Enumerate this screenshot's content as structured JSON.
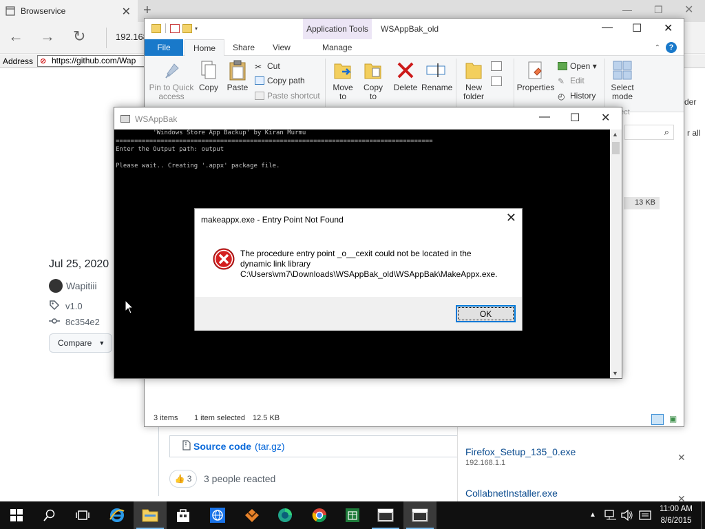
{
  "browser": {
    "tab_title": "Browservice",
    "url_partial": "192.168",
    "address_label": "Address",
    "address_value": "https://github.com/Wap",
    "release": {
      "date": "Jul 25, 2020",
      "user": "Wapitiii",
      "tag": "v1.0",
      "commit": "8c354e2",
      "compare_label": "Compare"
    },
    "asset": {
      "label": "Source code",
      "format": "(tar.gz)"
    },
    "reactions": {
      "count": "3",
      "text": "3 people reacted"
    },
    "downloads": [
      {
        "name": "Firefox_Setup_135_0.exe",
        "source": "192.168.1.1"
      },
      {
        "name": "CollabnetInstaller.exe",
        "source": ""
      }
    ],
    "right_strip": {
      "t1": "der",
      "t2": "r all"
    }
  },
  "explorer": {
    "app_tools_label": "Application Tools",
    "window_title": "WSAppBak_old",
    "tabs": {
      "file": "File",
      "home": "Home",
      "share": "Share",
      "view": "View",
      "manage": "Manage"
    },
    "ribbon": {
      "pin": "Pin to Quick access",
      "copy": "Copy",
      "paste": "Paste",
      "cut": "Cut",
      "copy_path": "Copy path",
      "paste_shortcut": "Paste shortcut",
      "move_to": "Move to",
      "copy_to": "Copy to",
      "delete": "Delete",
      "rename": "Rename",
      "new_folder": "New folder",
      "properties": "Properties",
      "open": "Open",
      "edit": "Edit",
      "history": "History",
      "select_mode": "Select mode",
      "select_partial": "ect"
    },
    "file_size": "13 KB",
    "status": {
      "items": "3 items",
      "selected": "1 item selected",
      "size": "12.5 KB"
    }
  },
  "console": {
    "title": "WSAppBak",
    "lines": [
      "          'Windows Store App Backup' by Kiran Murmu",
      "=====================================================================================",
      "Enter the Output path: output",
      "",
      "Please wait.. Creating '.appx' package file."
    ]
  },
  "dialog": {
    "title": "makeappx.exe - Entry Point Not Found",
    "message_line1": "The procedure entry point _o__cexit could not be located in the",
    "message_line2": "dynamic link library",
    "message_line3": "C:\\Users\\vm7\\Downloads\\WSAppBak_old\\WSAppBak\\MakeAppx.exe.",
    "ok_label": "OK"
  },
  "taskbar": {
    "time": "11:00 AM",
    "date": "8/6/2015",
    "icons": [
      "start-icon",
      "search-icon",
      "task-view-icon",
      "ie-icon",
      "file-explorer-icon",
      "store-icon",
      "network-globe-icon",
      "gimp-icon",
      "browser-icon",
      "chrome-icon",
      "excel-icon",
      "console-icon",
      "console2-icon"
    ]
  },
  "colors": {
    "file_tab": "#1979ca",
    "app_tools_bg": "#ece5f5",
    "link": "#0969da",
    "error_red": "#cc2222",
    "taskbar": "#101010"
  }
}
